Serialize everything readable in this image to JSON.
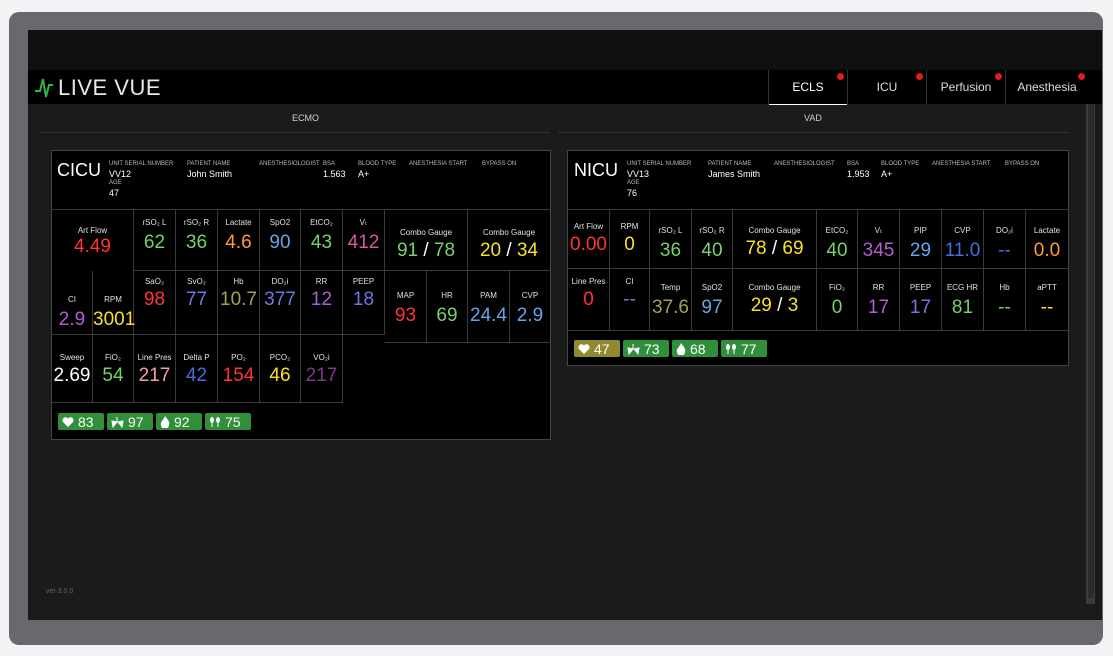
{
  "app": {
    "title": "LIVE VUE",
    "version": "ver 3.0.0"
  },
  "tabs": [
    {
      "label": "ECLS",
      "alert": true,
      "active": true
    },
    {
      "label": "ICU",
      "alert": true,
      "active": false
    },
    {
      "label": "Perfusion",
      "alert": true,
      "active": false
    },
    {
      "label": "Anesthesia",
      "alert": true,
      "active": false
    }
  ],
  "sections": {
    "left": "ECMO",
    "right": "VAD"
  },
  "colors": {
    "red": "#ff3434",
    "green": "#76d36c",
    "orange": "#ff9a3c",
    "blue": "#63a6e8",
    "purple": "#b05fd4",
    "yellow": "#f8e02a",
    "pink": "#d45aa4",
    "olive": "#a7a14e",
    "white": "#ffffff",
    "indigo": "#7276e0"
  },
  "ecmo": {
    "unit": "CICU",
    "header": {
      "serial_label": "UNIT SERIAL NUMBER",
      "serial": "VV12",
      "patient_label": "PATIENT NAME",
      "patient": "John Smith",
      "anes_label": "ANESTHESIOLOGIST",
      "bsa_label": "BSA",
      "bsa": "1.563",
      "blood_label": "BLOOD TYPE",
      "blood": "A+",
      "anes_start_label": "ANESTHESIA START",
      "bypass_label": "BYPASS ON",
      "age_label": "AGE",
      "age": "47"
    },
    "cells": {
      "artflow": {
        "label": "Art Flow",
        "value": "4.49"
      },
      "rso2l": {
        "label": "rSO₂ L",
        "value": "62"
      },
      "rso2r": {
        "label": "rSO₂ R",
        "value": "36"
      },
      "lactate": {
        "label": "Lactate",
        "value": "4.6"
      },
      "spo2": {
        "label": "SpO2",
        "value": "90"
      },
      "etco2": {
        "label": "EtCO₂",
        "value": "43"
      },
      "vt": {
        "label": "Vₜ",
        "value": "412"
      },
      "combo1": {
        "label": "Combo Gauge",
        "a": "91",
        "sep": "/",
        "b": "78"
      },
      "combo2": {
        "label": "Combo Gauge",
        "a": "20",
        "sep": "/",
        "b": "34"
      },
      "ci": {
        "label": "CI",
        "value": "2.9"
      },
      "rpm": {
        "label": "RPM",
        "value": "3001"
      },
      "sao2": {
        "label": "SaO₂",
        "value": "98"
      },
      "svo2": {
        "label": "SvO₂",
        "value": "77"
      },
      "hb": {
        "label": "Hb",
        "value": "10.7"
      },
      "do2i": {
        "label": "DO₂i",
        "value": "377"
      },
      "rr": {
        "label": "RR",
        "value": "12"
      },
      "peep": {
        "label": "PEEP",
        "value": "18"
      },
      "map": {
        "label": "MAP",
        "value": "93"
      },
      "hr": {
        "label": "HR",
        "value": "69"
      },
      "pam": {
        "label": "PAM",
        "value": "24.4"
      },
      "cvp": {
        "label": "CVP",
        "value": "2.9"
      },
      "sweep": {
        "label": "Sweep",
        "value": "2.69"
      },
      "fio2": {
        "label": "FiO₂",
        "value": "54"
      },
      "linepres": {
        "label": "Line Pres",
        "value": "217"
      },
      "deltap": {
        "label": "Delta P",
        "value": "42"
      },
      "po2": {
        "label": "PO₂",
        "value": "154"
      },
      "pco2": {
        "label": "PCO₂",
        "value": "46"
      },
      "vo2i": {
        "label": "VO₂i",
        "value": "217"
      }
    },
    "badges": [
      {
        "icon": "heart-icon",
        "value": "83"
      },
      {
        "icon": "lungs-icon",
        "value": "97"
      },
      {
        "icon": "flame-icon",
        "value": "92"
      },
      {
        "icon": "kidneys-icon",
        "value": "75"
      }
    ]
  },
  "vad": {
    "unit": "NICU",
    "header": {
      "serial_label": "UNIT SERIAL NUMBER",
      "serial": "VV13",
      "patient_label": "PATIENT NAME",
      "patient": "James Smith",
      "anes_label": "ANESTHESIOLOGIST",
      "bsa_label": "BSA",
      "bsa": "1.953",
      "blood_label": "BLOOD TYPE",
      "blood": "A+",
      "anes_start_label": "ANESTHESIA START",
      "bypass_label": "BYPASS ON",
      "age_label": "AGE",
      "age": "76"
    },
    "cells": {
      "artflow": {
        "label": "Art Flow",
        "value": "0.00"
      },
      "rpm": {
        "label": "RPM",
        "value": "0"
      },
      "rso2l": {
        "label": "rSO₂ L",
        "value": "36"
      },
      "rso2r": {
        "label": "rSO₂ R",
        "value": "40"
      },
      "combo1": {
        "label": "Combo Gauge",
        "a": "78",
        "sep": "/",
        "b": "69"
      },
      "etco2": {
        "label": "EtCO₂",
        "value": "40"
      },
      "vt": {
        "label": "Vₜ",
        "value": "345"
      },
      "pip": {
        "label": "PIP",
        "value": "29"
      },
      "cvp": {
        "label": "CVP",
        "value": "11.0"
      },
      "do2i": {
        "label": "DO₂i",
        "value": "--"
      },
      "lactate": {
        "label": "Lactate",
        "value": "0.0"
      },
      "linepres": {
        "label": "Line Pres",
        "value": "0"
      },
      "ci": {
        "label": "CI",
        "value": "--"
      },
      "temp": {
        "label": "Temp",
        "value": "37.6"
      },
      "spo2": {
        "label": "SpO2",
        "value": "97"
      },
      "combo2": {
        "label": "Combo Gauge",
        "a": "29",
        "sep": "/",
        "b": "3"
      },
      "fio2": {
        "label": "FiO₂",
        "value": "0"
      },
      "rr": {
        "label": "RR",
        "value": "17"
      },
      "peep": {
        "label": "PEEP",
        "value": "17"
      },
      "ecghr": {
        "label": "ECG HR",
        "value": "81"
      },
      "hb": {
        "label": "Hb",
        "value": "--"
      },
      "aptt": {
        "label": "aPTT",
        "value": "--"
      }
    },
    "badges": [
      {
        "icon": "heart-icon",
        "value": "47"
      },
      {
        "icon": "lungs-icon",
        "value": "73"
      },
      {
        "icon": "flame-icon",
        "value": "68"
      },
      {
        "icon": "kidneys-icon",
        "value": "77"
      }
    ]
  }
}
